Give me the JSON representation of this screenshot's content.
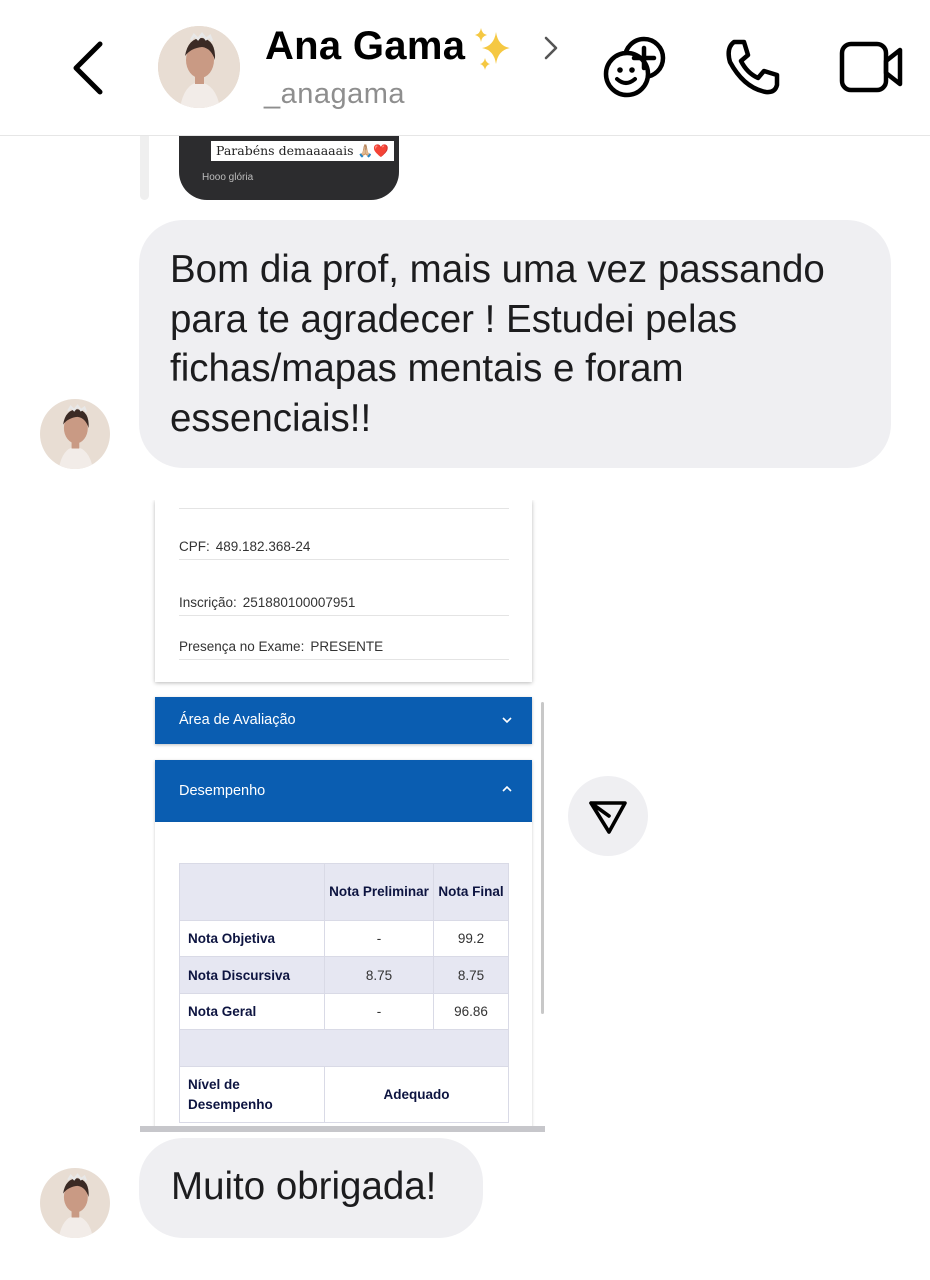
{
  "header": {
    "name": "Ana Gama",
    "name_emoji": "sparkles-emoji",
    "username": "_anagama",
    "icons": [
      "back-chevron-icon",
      "chevron-right-icon",
      "effects-icon",
      "phone-icon",
      "video-icon"
    ]
  },
  "shared_reel": {
    "caption": "Parabéns demaaaaais 🙏🏼❤️",
    "subtitle": "Hooo glória"
  },
  "messages": [
    {
      "text": "Bom dia prof, mais uma vez passando para te agradecer ! Estudei pelas fichas/mapas mentais e foram essenciais!!"
    },
    {
      "text": "Muito obrigada!"
    }
  ],
  "screenshot": {
    "info": [
      {
        "label": "CPF:",
        "value": "489.182.368-24"
      },
      {
        "label": "Inscrição:",
        "value": "251880100007951"
      },
      {
        "label": "Presença no Exame:",
        "value": "PRESENTE"
      }
    ],
    "panel_area": "Área de Avaliação",
    "panel_performance": "Desempenho",
    "table": {
      "header": [
        "",
        "Nota Preliminar",
        "Nota Final"
      ],
      "rows": [
        {
          "label": "Nota Objetiva",
          "preliminar": "-",
          "final": "99.2"
        },
        {
          "label": "Nota Discursiva",
          "preliminar": "8.75",
          "final": "8.75"
        },
        {
          "label": "Nota Geral",
          "preliminar": "-",
          "final": "96.86"
        }
      ],
      "level_label": "Nível de Desempenho",
      "level_value": "Adequado"
    }
  },
  "colors": {
    "bubble": "#efeff2",
    "panel_blue": "#0a5db1",
    "username_gray": "#8e8e8e"
  }
}
